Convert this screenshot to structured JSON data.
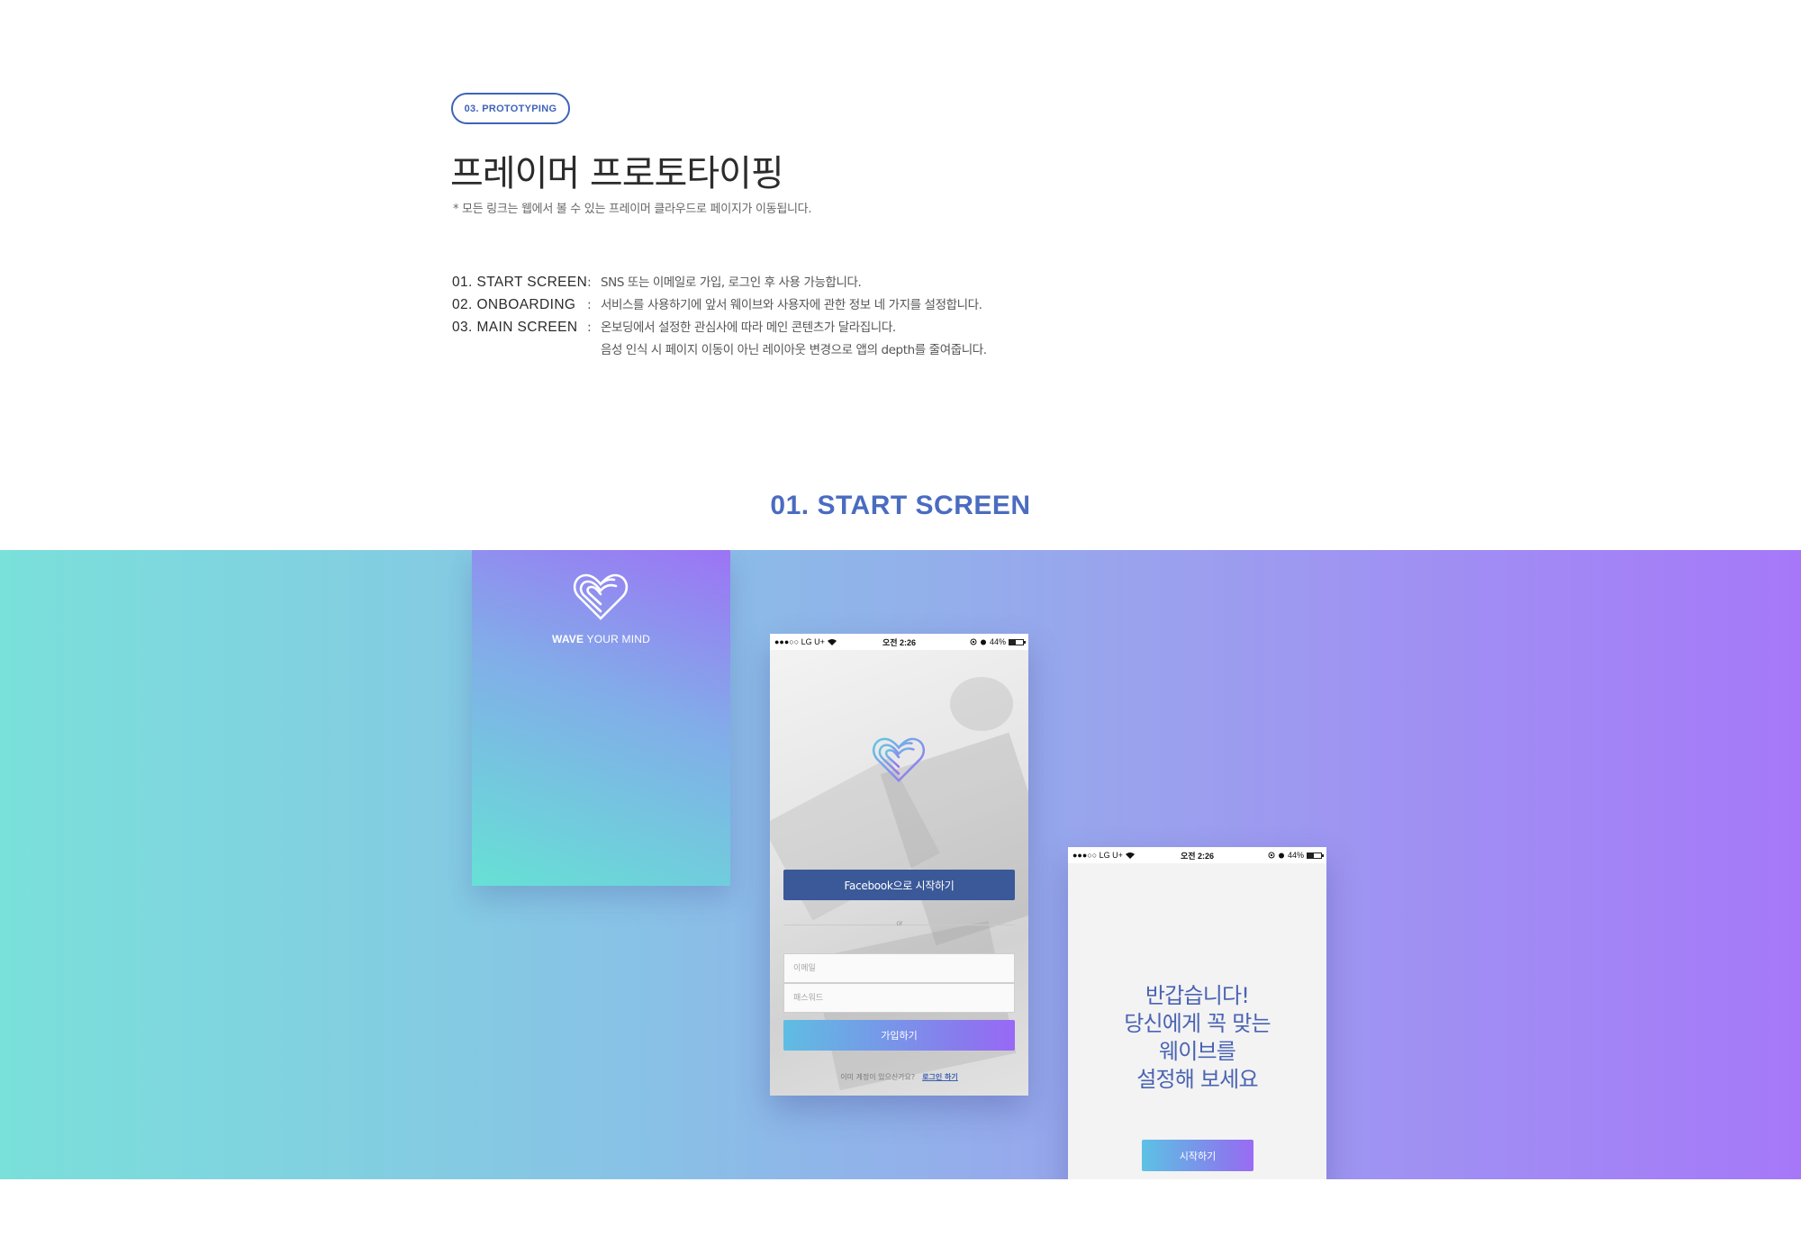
{
  "header": {
    "badge": "03. PROTOTYPING",
    "title": "프레이머 프로토타이핑",
    "note": "* 모든 링크는 웹에서 볼 수 있는 프레이머 클라우드로 페이지가 이동됩니다."
  },
  "descriptions": [
    {
      "label": "01. START SCREEN",
      "colon": ":",
      "text": "SNS 또는 이메일로 가입, 로그인 후 사용 가능합니다."
    },
    {
      "label": "02. ONBOARDING",
      "colon": ":",
      "text": "서비스를 사용하기에 앞서 웨이브와 사용자에 관한 정보 네 가지를 설정합니다."
    },
    {
      "label": "03. MAIN SCREEN",
      "colon": ":",
      "text": "온보딩에서 설정한 관심사에 따라 메인 콘텐츠가 달라집니다."
    },
    {
      "label": "",
      "colon": "",
      "text": "음성 인식 시 페이지 이동이 아닌 레이아웃 변경으로 앱의 depth를 줄여줍니다."
    }
  ],
  "section": {
    "title": "01. START SCREEN"
  },
  "splash": {
    "brand_bold": "WAVE",
    "brand_rest": " YOUR MIND",
    "logo_icon": "wave-heart-icon"
  },
  "statusbar": {
    "carrier": "●●●○○ LG U+",
    "wifi_icon": "wifi-icon",
    "time": "오전 2:26",
    "battery": "44%"
  },
  "login": {
    "facebook_button": "Facebook으로 시작하기",
    "or_text": "or",
    "email_placeholder": "이메일",
    "password_placeholder": "패스워드",
    "join_button": "가입하기",
    "footer_text": "이미 계정이 있으신가요?",
    "login_link": "로그인 하기"
  },
  "welcome": {
    "message_lines": [
      "반갑습니다!",
      "당신에게 꼭 맞는",
      "웨이브를",
      "설정해 보세요"
    ],
    "start_button": "시작하기"
  },
  "colors": {
    "accent": "#3f63b9",
    "section_title": "#4a6cc0",
    "facebook": "#3b5998",
    "gradient_start": "#7ae0da",
    "gradient_end": "#a678f9"
  }
}
